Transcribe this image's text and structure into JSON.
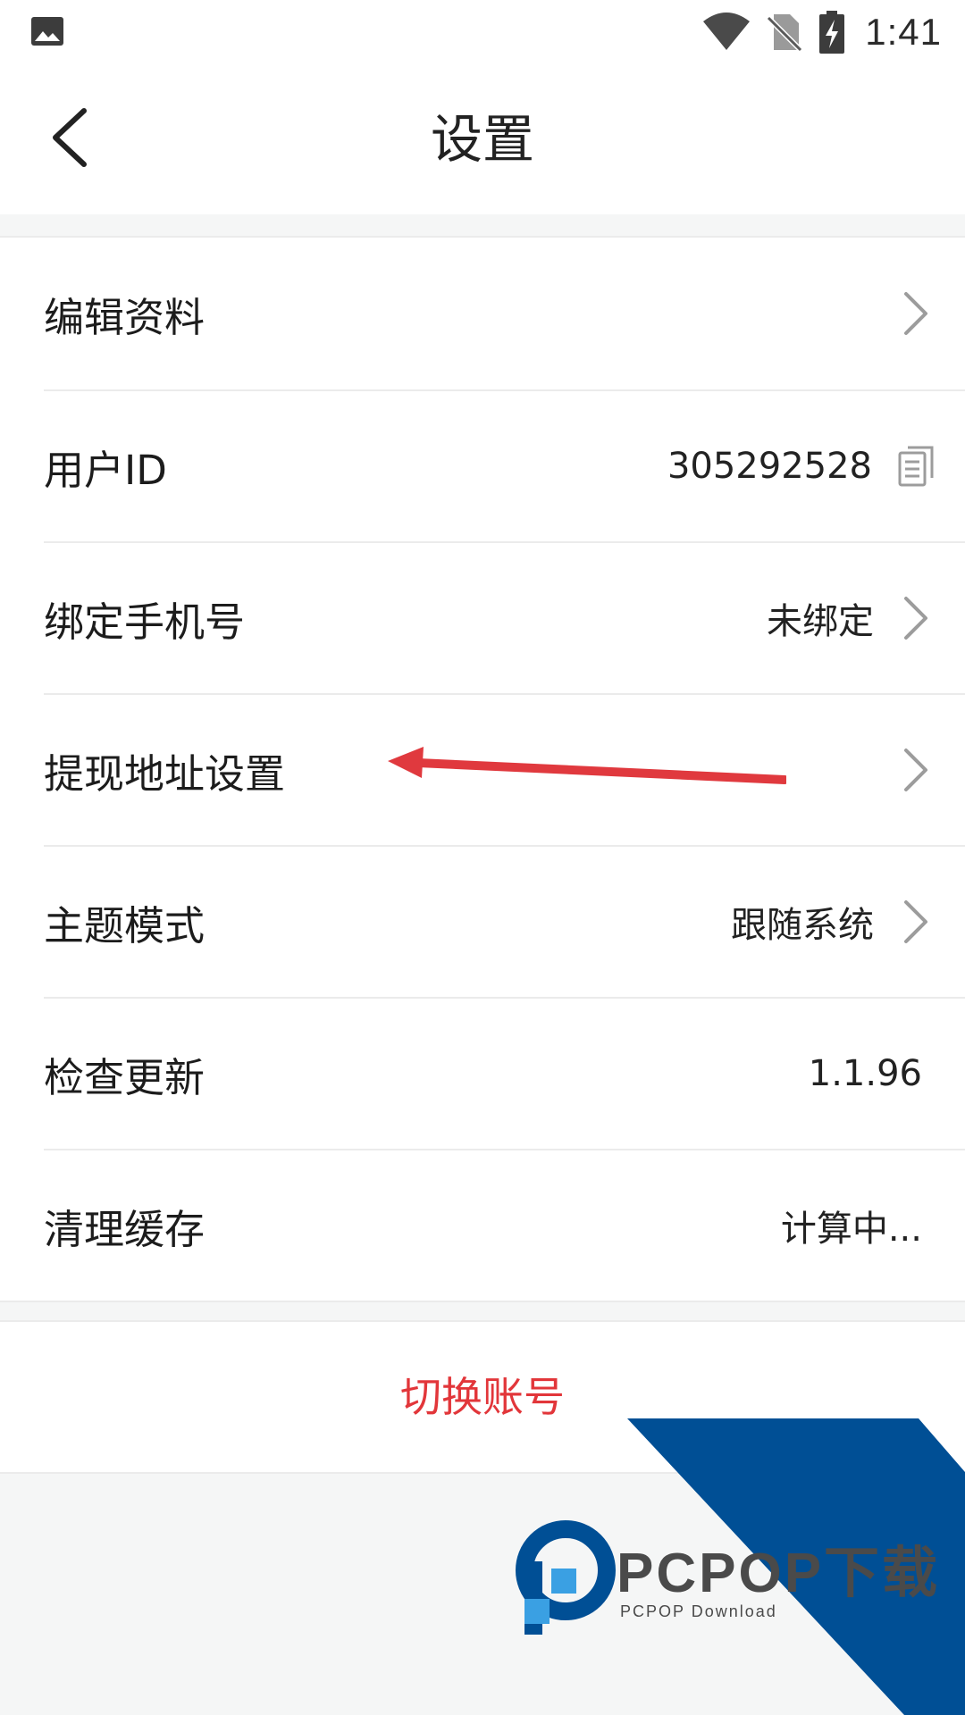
{
  "status_bar": {
    "time": "1:41",
    "icons": [
      "gallery-icon",
      "wifi-icon",
      "no-sim-icon",
      "battery-charging-icon"
    ]
  },
  "header": {
    "title": "设置",
    "back_icon": "chevron-left-icon"
  },
  "settings": {
    "items": [
      {
        "label": "编辑资料",
        "value": "",
        "trailing": "chevron-right-icon"
      },
      {
        "label": "用户ID",
        "value": "305292528",
        "trailing": "copy-icon"
      },
      {
        "label": "绑定手机号",
        "value": "未绑定",
        "trailing": "chevron-right-icon"
      },
      {
        "label": "提现地址设置",
        "value": "",
        "trailing": "chevron-right-icon"
      },
      {
        "label": "主题模式",
        "value": "跟随系统",
        "trailing": "chevron-right-icon"
      },
      {
        "label": "检查更新",
        "value": "1.1.96",
        "trailing": ""
      },
      {
        "label": "清理缓存",
        "value": "计算中...",
        "trailing": ""
      }
    ]
  },
  "actions": {
    "switch_account": "切换账号"
  },
  "watermark": {
    "brand": "PCPOP下载",
    "subtitle": "PCPOP Download"
  },
  "colors": {
    "danger": "#e2363a",
    "annotation_arrow": "#e0393e",
    "divider": "#ebebeb",
    "background": "#f5f6f6",
    "watermark_blue": "#004f95",
    "watermark_light_blue": "#3aa0e3"
  }
}
